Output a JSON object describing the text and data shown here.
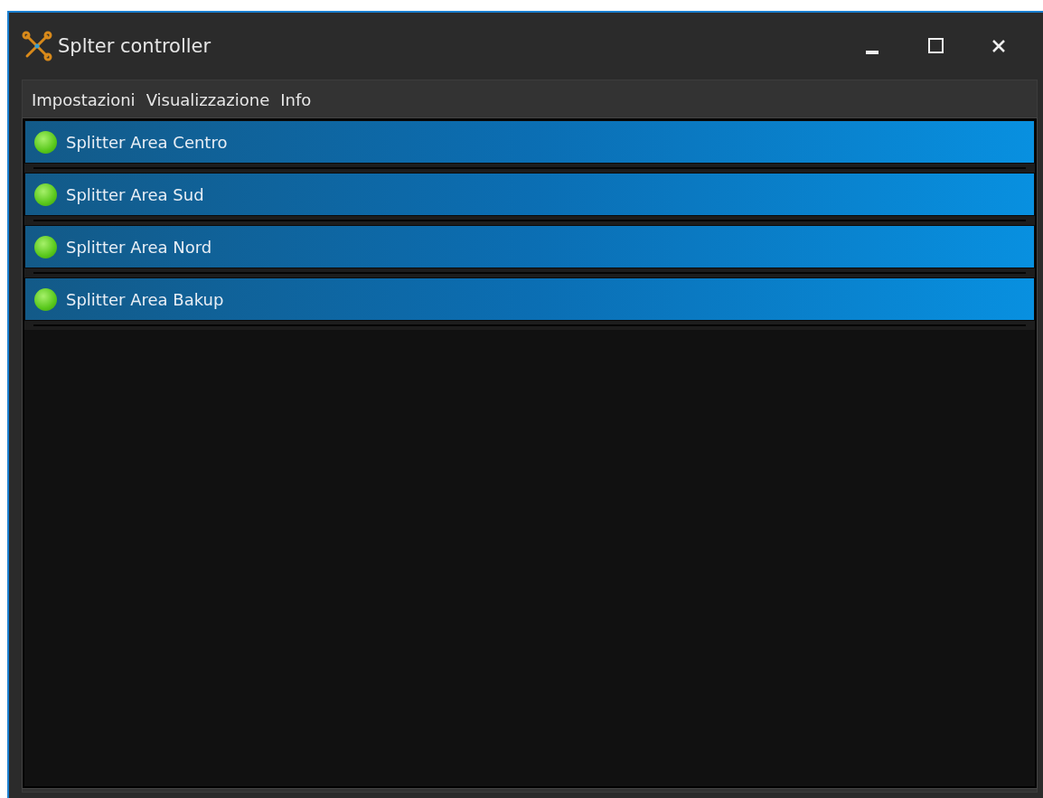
{
  "window": {
    "title": "Splter controller"
  },
  "menu": [
    {
      "label": "Impostazioni"
    },
    {
      "label": "Visualizzazione"
    },
    {
      "label": "Info"
    }
  ],
  "splitters": [
    {
      "name": "Splitter Area Centro",
      "connected": true
    },
    {
      "name": "Splitter Area Sud",
      "connected": true
    },
    {
      "name": "Splitter Area Nord",
      "connected": true
    },
    {
      "name": "Splitter Area Bakup",
      "connected": true
    }
  ]
}
